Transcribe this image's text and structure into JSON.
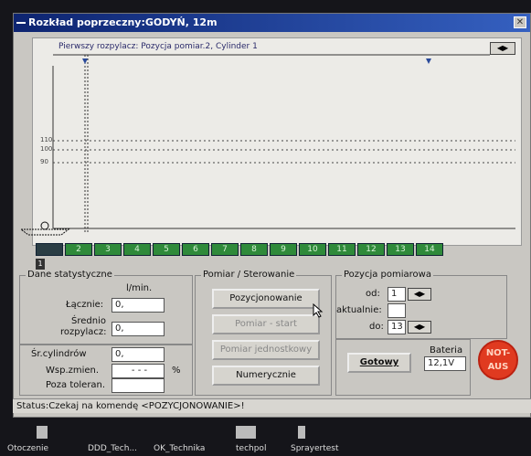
{
  "window": {
    "title": "Rozkład poprzeczny:GODYŃ, 12m",
    "close_icon": "close-icon"
  },
  "chart_header": {
    "text": "Pierwszy rozpylacz: Pozycja pomiar.2,  Cylinder 1"
  },
  "chart_data": {
    "type": "line",
    "ytick_labels": [
      "110",
      "100",
      "90"
    ]
  },
  "cylinders": [
    "",
    "2",
    "3",
    "4",
    "5",
    "6",
    "7",
    "8",
    "9",
    "10",
    "11",
    "12",
    "13",
    "14"
  ],
  "marker": "1",
  "stats": {
    "title": "Dane statystyczne",
    "unit": "l/min.",
    "total_label": "Łącznie:",
    "total_value": "0,",
    "avg_label_1": "Średnio",
    "avg_label_2": "rozpylacz:",
    "avg_value": "0,",
    "cyl_label": "Śr.cylindrów",
    "cyl_value": "0,",
    "var_label": "Wsp.zmien.",
    "var_value": "- - -",
    "var_unit": "%",
    "tol_label": "Poza toleran.",
    "tol_value": ""
  },
  "control": {
    "title": "Pomiar / Sterowanie",
    "btn_pos": "Pozycjonowanie",
    "btn_start": "Pomiar - start",
    "btn_single": "Pomiar jednostkowy",
    "btn_num": "Numerycznie"
  },
  "position": {
    "title": "Pozycja pomiarowa",
    "from_label": "od:",
    "from_value": "1",
    "current_label": "aktualnie:",
    "to_label": "do:",
    "to_value": "13"
  },
  "ready": {
    "btn": "Gotowy",
    "battery_label": "Bateria",
    "battery_value": "12,1V"
  },
  "emergency": {
    "line1": "NOT-",
    "line2": "AUS"
  },
  "status": {
    "text": "Status:Czekaj na komendę <POZYCJONOWANIE>!"
  },
  "taskbar": [
    "Otoczenie",
    "DDD_Tech...",
    "OK_Technika",
    "techpol",
    "Sprayertest"
  ]
}
